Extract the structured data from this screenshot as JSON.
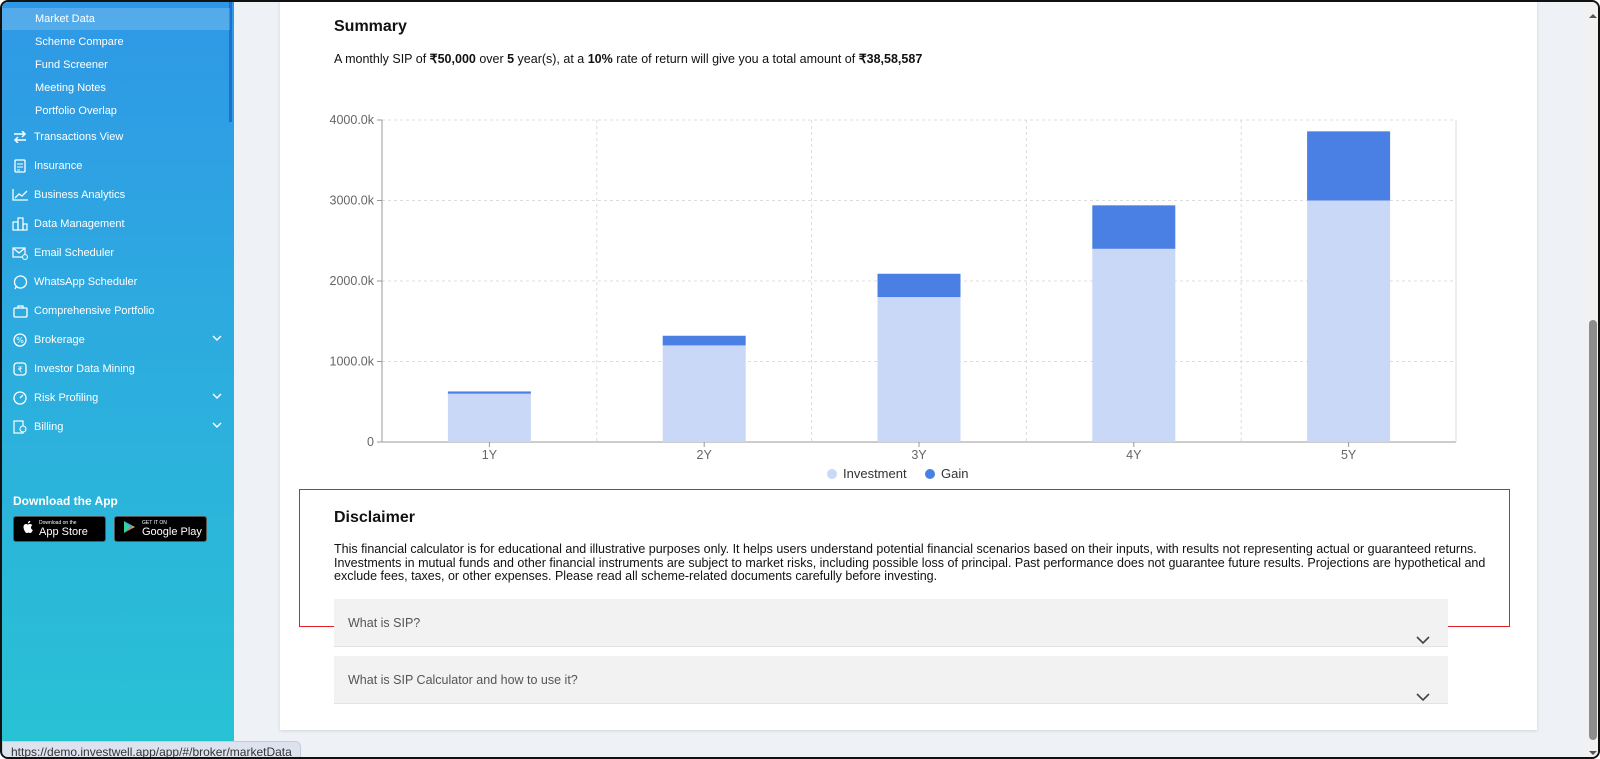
{
  "sidebar": {
    "sub_items": [
      {
        "label": "Market Data",
        "active": true
      },
      {
        "label": "Scheme Compare"
      },
      {
        "label": "Fund Screener"
      },
      {
        "label": "Meeting Notes"
      },
      {
        "label": "Portfolio Overlap"
      }
    ],
    "items": [
      {
        "label": "Transactions View",
        "icon": "transactions-icon",
        "chevron": false
      },
      {
        "label": "Insurance",
        "icon": "insurance-icon",
        "chevron": false
      },
      {
        "label": "Business Analytics",
        "icon": "analytics-icon",
        "chevron": false
      },
      {
        "label": "Data Management",
        "icon": "database-icon",
        "chevron": false
      },
      {
        "label": "Email Scheduler",
        "icon": "email-icon",
        "chevron": false
      },
      {
        "label": "WhatsApp Scheduler",
        "icon": "whatsapp-icon",
        "chevron": false
      },
      {
        "label": "Comprehensive Portfolio",
        "icon": "briefcase-icon",
        "chevron": false
      },
      {
        "label": "Brokerage",
        "icon": "percent-icon",
        "chevron": true
      },
      {
        "label": "Investor Data Mining",
        "icon": "rupee-icon",
        "chevron": false
      },
      {
        "label": "Risk Profiling",
        "icon": "gauge-icon",
        "chevron": true
      },
      {
        "label": "Billing",
        "icon": "billing-icon",
        "chevron": true
      }
    ],
    "download": {
      "title": "Download the App",
      "app_store_small": "Download on the",
      "app_store_big": "App Store",
      "google_play_small": "GET IT ON",
      "google_play_big": "Google Play"
    }
  },
  "summary": {
    "title": "Summary",
    "t1": "A monthly SIP of ",
    "amount": "₹50,000",
    "t2": " over ",
    "years": "5",
    "t3": " year(s), at a ",
    "rate": "10%",
    "t4": " rate of return will give you a total amount of ",
    "total": "₹38,58,587"
  },
  "chart_data": {
    "type": "bar",
    "stacked": true,
    "categories": [
      "1Y",
      "2Y",
      "3Y",
      "4Y",
      "5Y"
    ],
    "series": [
      {
        "name": "Investment",
        "values": [
          600,
          1200,
          1800,
          2400,
          3000
        ]
      },
      {
        "name": "Gain",
        "values": [
          28,
          120,
          290,
          540,
          859
        ]
      }
    ],
    "ylim": [
      0,
      4000
    ],
    "yticks": [
      0,
      1000,
      2000,
      3000,
      4000
    ],
    "ytick_labels": [
      "0",
      "1000.0k",
      "2000.0k",
      "3000.0k",
      "4000.0k"
    ],
    "grid": true,
    "legend": "bottom",
    "colors": {
      "Investment": "#c9d8f6",
      "Gain": "#4a7fe4"
    }
  },
  "disclaimer": {
    "title": "Disclaimer",
    "text": "This financial calculator is for educational and illustrative purposes only. It helps users understand potential financial scenarios based on their inputs, with results not representing actual or guaranteed returns. Investments in mutual funds and other financial instruments are subject to market risks, including possible loss of principal. Past performance does not guarantee future results. Projections are hypothetical and exclude fees, taxes, or other expenses. Please read all scheme-related documents carefully before investing."
  },
  "faq": [
    {
      "question": "What is SIP?"
    },
    {
      "question": "What is SIP Calculator and how to use it?"
    }
  ],
  "status_bar": {
    "url": "https://demo.investwell.app/app/#/broker/marketData"
  }
}
